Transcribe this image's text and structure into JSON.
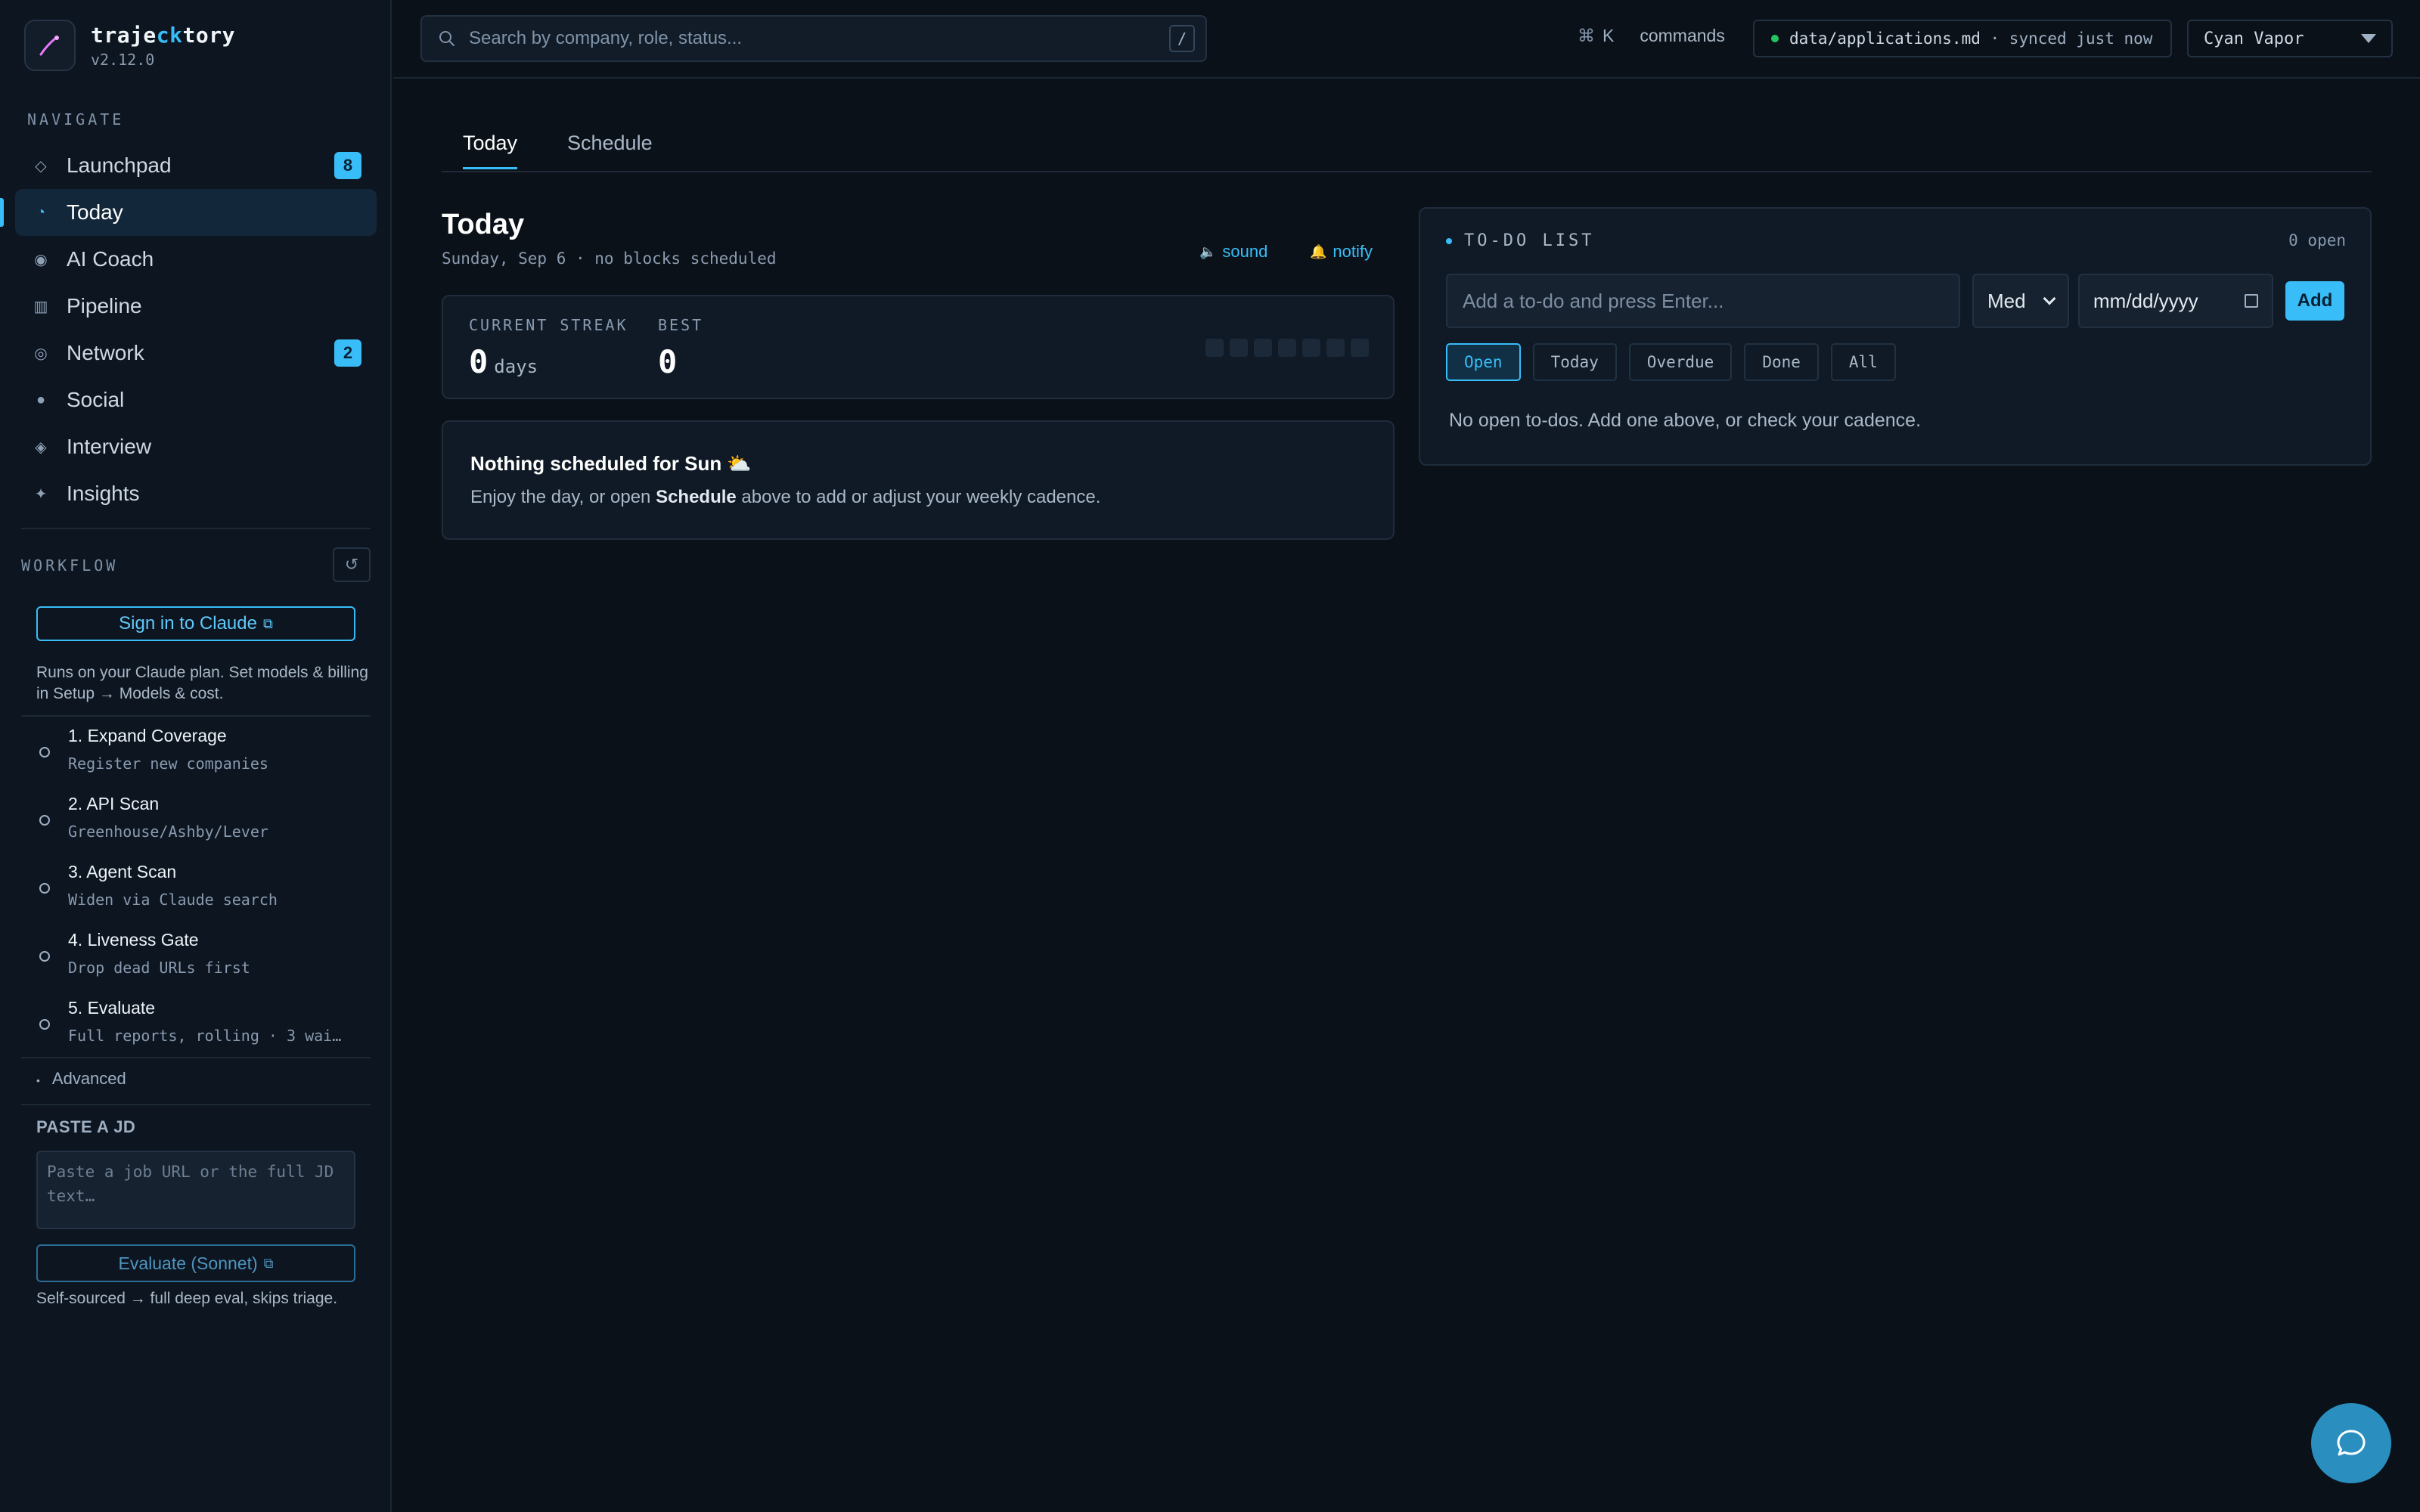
{
  "brand": {
    "name_prefix": "traje",
    "name_highlight": "ck",
    "name_suffix": "tory",
    "version": "v2.12.0"
  },
  "nav": {
    "section_label": "NAVIGATE",
    "items": [
      {
        "label": "Launchpad",
        "icon": "diamond-icon",
        "badge": "8"
      },
      {
        "label": "Today",
        "icon": "clock-icon",
        "active": true
      },
      {
        "label": "AI Coach",
        "icon": "target-icon"
      },
      {
        "label": "Pipeline",
        "icon": "columns-icon"
      },
      {
        "label": "Network",
        "icon": "network-icon",
        "badge": "2"
      },
      {
        "label": "Social",
        "icon": "social-icon"
      },
      {
        "label": "Interview",
        "icon": "interview-icon"
      },
      {
        "label": "Insights",
        "icon": "sparkle-icon"
      }
    ]
  },
  "workflow": {
    "section_label": "WORKFLOW",
    "reset_icon": "refresh-icon",
    "signin_label": "Sign in to Claude",
    "plan_note": "Runs on your Claude plan. Set models & billing in Setup → Models & cost.",
    "steps": [
      {
        "title": "1. Expand Coverage",
        "subtitle": "Register new companies"
      },
      {
        "title": "2. API Scan",
        "subtitle": "Greenhouse/Ashby/Lever"
      },
      {
        "title": "3. Agent Scan",
        "subtitle": "Widen via Claude search"
      },
      {
        "title": "4. Liveness Gate",
        "subtitle": "Drop dead URLs first"
      },
      {
        "title": "5. Evaluate",
        "subtitle": "Full reports, rolling · 3 wai…"
      }
    ],
    "advanced_label": "Advanced"
  },
  "paste_jd": {
    "label": "PASTE A JD",
    "placeholder": "Paste a job URL or the full JD text…",
    "button_label": "Evaluate (Sonnet)",
    "note": "Self-sourced → full deep eval, skips triage."
  },
  "topbar": {
    "search_placeholder": "Search by company, role, status...",
    "search_shortcut": "/",
    "cmd_symbol": "⌘",
    "cmd_key": "K",
    "cmd_label": "commands",
    "sync_path": "data/applications.md",
    "sync_status": " · synced just now",
    "theme_value": "Cyan Vapor"
  },
  "tabs": [
    {
      "label": "Today",
      "active": true
    },
    {
      "label": "Schedule"
    }
  ],
  "today": {
    "title": "Today",
    "subtitle": "Sunday, Sep 6 · no blocks scheduled",
    "sound_label": "sound",
    "notify_label": "notify",
    "streak": {
      "current_label": "CURRENT STREAK",
      "current_value": "0",
      "current_unit": "days",
      "best_label": "BEST",
      "best_value": "0",
      "boxes": 7
    },
    "nothing": {
      "title": "Nothing scheduled for Sun ⛅",
      "body_prefix": "Enjoy the day, or open ",
      "body_link": "Schedule",
      "body_suffix": " above to add or adjust your weekly cadence."
    }
  },
  "todo": {
    "heading": "TO-DO LIST",
    "count": "0 open",
    "input_placeholder": "Add a to-do and press Enter...",
    "priority": "Med",
    "date_placeholder": "mm/dd/yyyy",
    "add_label": "Add",
    "filters": [
      "Open",
      "Today",
      "Overdue",
      "Done",
      "All"
    ],
    "active_filter": "Open",
    "empty_text": "No open to-dos. Add one above, or check your cadence."
  },
  "colors": {
    "accent": "#38bdf8",
    "background": "#0b1119",
    "sync_ok": "#22c55e"
  }
}
